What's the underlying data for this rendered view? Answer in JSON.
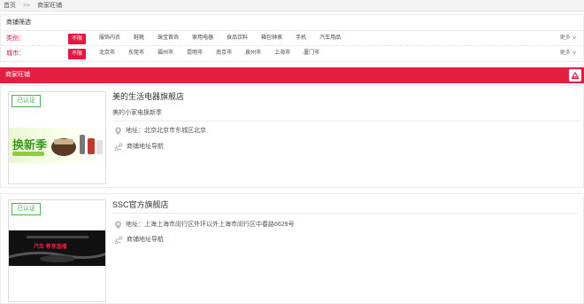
{
  "breadcrumb": {
    "home": "首页",
    "sep": ">>",
    "current": "商家旺铺"
  },
  "filter": {
    "title": "商铺筛选",
    "category": {
      "label": "类别：",
      "options": [
        "不限",
        "服饰内衣",
        "鞋靴",
        "珠宝首饰",
        "家用电器",
        "食品饮料",
        "箱包钟表",
        "手机",
        "汽车用品"
      ],
      "active_index": 0,
      "more": "更多"
    },
    "city": {
      "label": "城市：",
      "options": [
        "不限",
        "北京市",
        "东莞市",
        "福州市",
        "昆明市",
        "南京市",
        "泉州市",
        "上海市",
        "厦门市"
      ],
      "active_index": 0,
      "more": "更多"
    }
  },
  "section": {
    "title": "商家旺铺",
    "button_icon": "refresh-icon"
  },
  "shops": [
    {
      "name": "美的生活电器旗舰店",
      "slogan": "美的小家电换新季",
      "certified": "已认证",
      "address": "地址：北京北京市东城区北京",
      "navigation": "商铺地址导航",
      "banner_text": "换新季"
    },
    {
      "name": "SSC官方旗舰店",
      "slogan": "",
      "certified": "已认证",
      "address": "地址：上海上海市闵行区外环以外上海市闵行区中春路6629号",
      "navigation": "商铺地址导航",
      "banner_text": "汽车 尊享直播"
    }
  ],
  "colors": {
    "accent": "#e31e41",
    "certified": "#4caf50"
  }
}
